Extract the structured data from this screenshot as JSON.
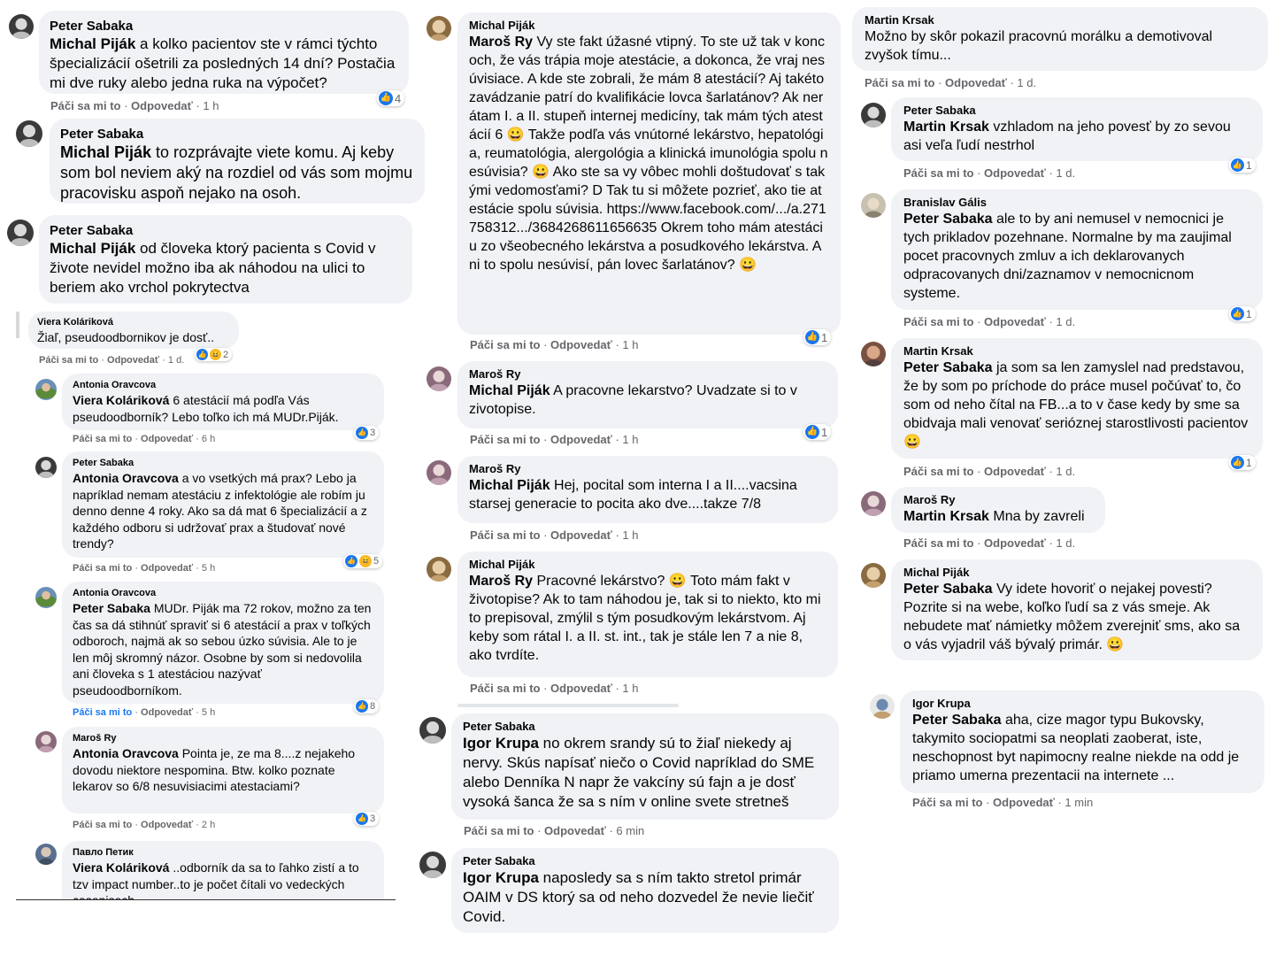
{
  "colors": {
    "bubble": "#f0f2f5",
    "like": "#1877f2",
    "meta": "#65676b",
    "haha": "#f7b928"
  },
  "columns": [
    {
      "comments": [
        {
          "author": "Peter Sabaka",
          "mention": "Michal Piják",
          "text": " a kolko pacientov ste v rámci týchto špecializácií ošetrili za posledných 14 dní? Postačia mi dve ruky alebo jedna ruka na výpočet?",
          "like": "Páči sa mi to",
          "reply": "Odpovedať",
          "time": "1 h",
          "reactions": "4"
        },
        {
          "author": "Peter Sabaka",
          "mention": "Michal Piják",
          "text": " to rozprávajte viete komu. Aj keby som bol neviem aký na rozdiel od vás som mojmu pracovisku aspoň nejako na osoh."
        },
        {
          "author": "Peter Sabaka",
          "mention": "Michal Piják",
          "text": " od človeka ktorý pacienta s Covid v živote nevidel možno iba ak náhodou na ulici to beriem ako vrchol pokrytectva"
        },
        {
          "author": "Viera Koláriková",
          "mention": "",
          "text": "Žiaľ, pseudoodbornikov je dosť..",
          "like": "Páči sa mi to",
          "reply": "Odpovedať",
          "time": "1 d.",
          "reactions": "2"
        },
        {
          "author": "Antonia Oravcova",
          "mention": "Viera Koláriková",
          "text": " 6 atestácií má podľa Vás pseudoodborník? Lebo toľko ich má MUDr.Piják.",
          "like": "Páči sa mi to",
          "reply": "Odpovedať",
          "time": "6 h",
          "reactions": "3"
        },
        {
          "author": "Peter Sabaka",
          "mention": "Antonia Oravcova",
          "text": " a vo vsetkých má prax? Lebo ja napríklad nemam atestáciu z infektológie ale robím ju denno denne 4 roky. Ako sa dá mat 6 špecializácií a z každého odboru si udržovať prax a študovať nové trendy?",
          "like": "Páči sa mi to",
          "reply": "Odpovedať",
          "time": "5 h",
          "reactions": "5"
        },
        {
          "author": "Antonia Oravcova",
          "mention": "Peter Sabaka",
          "text": " MUDr. Piják ma 72 rokov, možno za ten čas sa dá stihnúť spraviť si 6 atestácií a prax v toľkých odboroch, najmä ak so sebou úzko súvisia. Ale to je len môj skromný názor. Osobne by som si nedovolila ani človeka s 1 atestáciou nazývať pseudoodborníkom.",
          "like": "Páči sa mi to",
          "reply": "Odpovedať",
          "time": "5 h",
          "reactions": "8"
        },
        {
          "author": "Maroš Ry",
          "mention": "Antonia Oravcova",
          "text": " Pointa je, ze ma 8....z nejakeho dovodu niektore nespomina. Btw. kolko poznate lekarov so 6/8 nesuvisiacimi atestaciami?",
          "like": "Páči sa mi to",
          "reply": "Odpovedať",
          "time": "2 h",
          "reactions": "3"
        },
        {
          "author": "Павло Петик",
          "mention": "Viera Koláriková",
          "text": " ..odborník da sa to ľahko zistí a to tzv impact number..to je počet čítali vo vedeckých casopisoch"
        }
      ]
    },
    {
      "comments": [
        {
          "author": "Michal Piják",
          "mention": "Maroš Ry",
          "text": " Vy ste fakt úžasné vtipný. To ste už tak v koncoch, že vás trápia moje atestácie, a dokonca, že vraj nesúvisiace. A kde ste zobrali, že mám 8 atestácií? Aj takéto zavádzanie patrí do kvalifikácie lovca šarlatánov? Ak nerátam I. a II. stupeň internej medicíny, tak mám tých atestácií 6 😀 Takže podľa vás vnútorné lekárstvo, hepatológia, reumatológia, alergológia a klinická imunológia spolu nesúvisia? 😀 Ako ste sa vy vôbec mohli doštudovať s takými vedomosťami? D Tak tu si môžete pozrieť, ako tie atestácie spolu súvisia. https://www.facebook.com/.../a.271758312.../3684268611656635 Okrem toho mám atestáciu zo všeobecného lekárstva a posudkového lekárstva. Ani to spolu nesúvisí, pán lovec šarlatánov? 😀",
          "like": "Páči sa mi to",
          "reply": "Odpovedať",
          "time": "1 h",
          "reactions": "1"
        },
        {
          "author": "Maroš Ry",
          "mention": "Michal Piják",
          "text": " A pracovne lekarstvo? Uvadzate si to v zivotopise.",
          "like": "Páči sa mi to",
          "reply": "Odpovedať",
          "time": "1 h",
          "reactions": "1"
        },
        {
          "author": "Maroš Ry",
          "mention": "Michal Piják",
          "text": " Hej, pocital som interna I a II....vacsina starsej generacie to pocita ako dve....takze 7/8",
          "like": "Páči sa mi to",
          "reply": "Odpovedať",
          "time": "1 h"
        },
        {
          "author": "Michal Piják",
          "mention": "Maroš Ry",
          "text": " Pracovné lekárstvo? 😀 Toto mám fakt v životopise? Ak to tam náhodou je, tak si to niekto, kto mi to prepisoval, zmýlil s tým posudkovým lekárstvom. Aj keby som rátal I. a II. st. int., tak je stále len 7 a nie 8, ako tvrdíte.",
          "like": "Páči sa mi to",
          "reply": "Odpovedať",
          "time": "1 h"
        },
        {
          "author": "Peter Sabaka",
          "mention": "Igor Krupa",
          "text": " no okrem srandy sú to žiaľ niekedy aj nervy. Skús napísať niečo o Covid napríklad do SME alebo Denníka N napr že vakcíny sú fajn a je dosť vysoká šanca že sa s ním v online svete stretneš",
          "like": "Páči sa mi to",
          "reply": "Odpovedať",
          "time": "6 min"
        },
        {
          "author": "Peter Sabaka",
          "mention": "Igor Krupa",
          "text": " naposledy sa s ním takto stretol primár OAIM v DS ktorý sa od neho dozvedel že nevie liečiť Covid."
        }
      ]
    },
    {
      "comments": [
        {
          "author": "Martin Krsak",
          "mention": "",
          "text": "Možno by skôr pokazil pracovnú morálku a demotivoval zvyšok tímu...",
          "like": "Páči sa mi to",
          "reply": "Odpovedať",
          "time": "1 d."
        },
        {
          "author": "Peter Sabaka",
          "mention": "Martin Krsak",
          "text": " vzhladom na jeho povesť by zo sevou asi veľa ľudí nestrhol",
          "like": "Páči sa mi to",
          "reply": "Odpovedať",
          "time": "1 d.",
          "reactions": "1"
        },
        {
          "author": "Branislav Gális",
          "mention": "Peter Sabaka",
          "text": " ale to by ani nemusel v nemocnici je tych prikladov pozehnane. Normalne by ma zaujimal pocet pracovnych zmluv a ich deklarovanych odpracovanych dni/zaznamov v nemocnicnom systeme.",
          "like": "Páči sa mi to",
          "reply": "Odpovedať",
          "time": "1 d.",
          "reactions": "1"
        },
        {
          "author": "Martin Krsak",
          "mention": "Peter Sabaka",
          "text": " ja som sa len zamyslel nad predstavou, že by som po príchode do práce musel počúvať to, čo som od neho čítal na FB...a to v čase kedy by sme sa obidvaja mali venovať serióznej starostlivosti pacientov 😀",
          "like": "Páči sa mi to",
          "reply": "Odpovedať",
          "time": "1 d.",
          "reactions": "1"
        },
        {
          "author": "Maroš Ry",
          "mention": "Martin Krsak",
          "text": " Mna by zavreli",
          "like": "Páči sa mi to",
          "reply": "Odpovedať",
          "time": "1 d."
        },
        {
          "author": "Michal Piják",
          "mention": "Peter Sabaka",
          "text": " Vy idete hovoriť o nejakej povesti? Pozrite si na webe, koľko ľudí sa z vás smeje. Ak nebudete mať námietky môžem zverejniť sms, ako sa o vás vyjadril váš bývalý primár. 😀"
        },
        {
          "author": "Igor Krupa",
          "mention": "Peter Sabaka",
          "text": " aha, cize magor typu Bukovsky, takymito sociopatmi sa neoplati zaoberat, iste, neschopnost byt napimocny realne niekde na odd je priamo umerna prezentacii na internete ...",
          "like": "Páči sa mi to",
          "reply": "Odpovedať",
          "time": "1 min"
        }
      ]
    }
  ]
}
